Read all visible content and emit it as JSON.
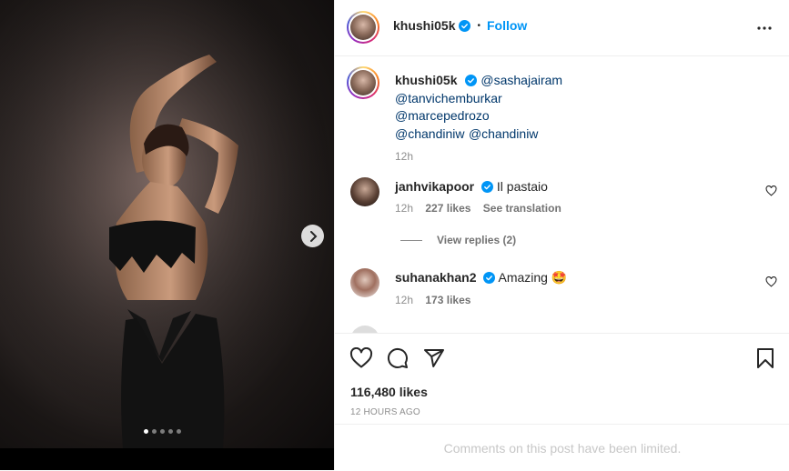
{
  "post": {
    "author": "khushi05k",
    "follow_label": "Follow",
    "separator": "•",
    "more_icon": "more-horizontal-icon",
    "carousel": {
      "dot_count": 5,
      "active_index": 0
    }
  },
  "caption": {
    "username": "khushi05k",
    "mention_1": "@sashajairam",
    "mention_2": "@tanvichemburkar",
    "mention_3": "@marcepedrozo",
    "mention_4": "@chandiniw",
    "mention_5": "@chandiniw",
    "time": "12h"
  },
  "comments": [
    {
      "username": "janhvikapoor",
      "text": "Il pastaio",
      "time": "12h",
      "likes": "227 likes",
      "translate": "See translation",
      "replies": "View replies (2)"
    },
    {
      "username": "suhanakhan2",
      "text": "Amazing 🤩",
      "time": "12h",
      "likes": "173 likes"
    }
  ],
  "actions": {
    "like_icon": "heart-icon",
    "comment_icon": "comment-icon",
    "share_icon": "share-icon",
    "save_icon": "bookmark-icon"
  },
  "likes_count": "116,480 likes",
  "timestamp": "12 HOURS AGO",
  "comments_limited": "Comments on this post have been limited.",
  "colors": {
    "accent": "#0095f6",
    "verified": "#0095f6",
    "link": "#00376b",
    "muted": "#8e8e8e"
  }
}
